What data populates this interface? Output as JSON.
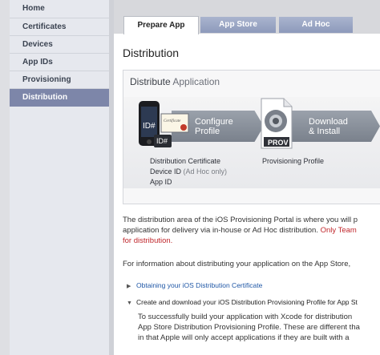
{
  "sidebar": {
    "items": [
      {
        "label": "Home"
      },
      {
        "label": "Certificates"
      },
      {
        "label": "Devices"
      },
      {
        "label": "App IDs"
      },
      {
        "label": "Provisioning"
      },
      {
        "label": "Distribution"
      }
    ],
    "active_index": 5
  },
  "tabs": [
    {
      "label": "Prepare App"
    },
    {
      "label": "App Store"
    },
    {
      "label": "Ad Hoc"
    }
  ],
  "page_title": "Distribution",
  "distribute_box": {
    "title_bold": "Distribute",
    "title_rest": " Application",
    "step1": {
      "label_line1": "Configure",
      "label_line2": "Profile",
      "phone_badge": "ID#",
      "card_badge": "ID#",
      "certificate_text": "Certificate",
      "caption_line1": "Distribution Certificate",
      "caption_line2": "Device ID",
      "caption_line2_muted": " (Ad Hoc only)",
      "caption_line3": "App ID"
    },
    "step2": {
      "label_line1": "Download",
      "label_line2": "& Install",
      "badge": "PROV",
      "caption": "Provisioning Profile"
    }
  },
  "intro": {
    "line1": "The distribution area of the iOS Provisioning Portal is where you will p",
    "line2_black": "application for delivery via in-house or Ad Hoc distribution. ",
    "line2_red": "Only Team",
    "line3_red": "for distribution."
  },
  "info_line": "For information about distributing your application on the App Store, ",
  "links": [
    {
      "text": "Obtaining your iOS Distribution Certificate",
      "expanded": false
    },
    {
      "text": "Create and download your iOS Distribution Provisioning Profile for App St",
      "expanded": true
    }
  ],
  "expanded_text": {
    "line1": "To successfully build your application with Xcode for distribution",
    "line2": "App Store Distribution Provisioning Profile. These are different tha",
    "line3": "in that Apple will only accept applications if they are built with a"
  },
  "colors": {
    "sidebar_active": "#7d86a9",
    "link_blue": "#1f57a6",
    "warning_red": "#c0282d"
  }
}
